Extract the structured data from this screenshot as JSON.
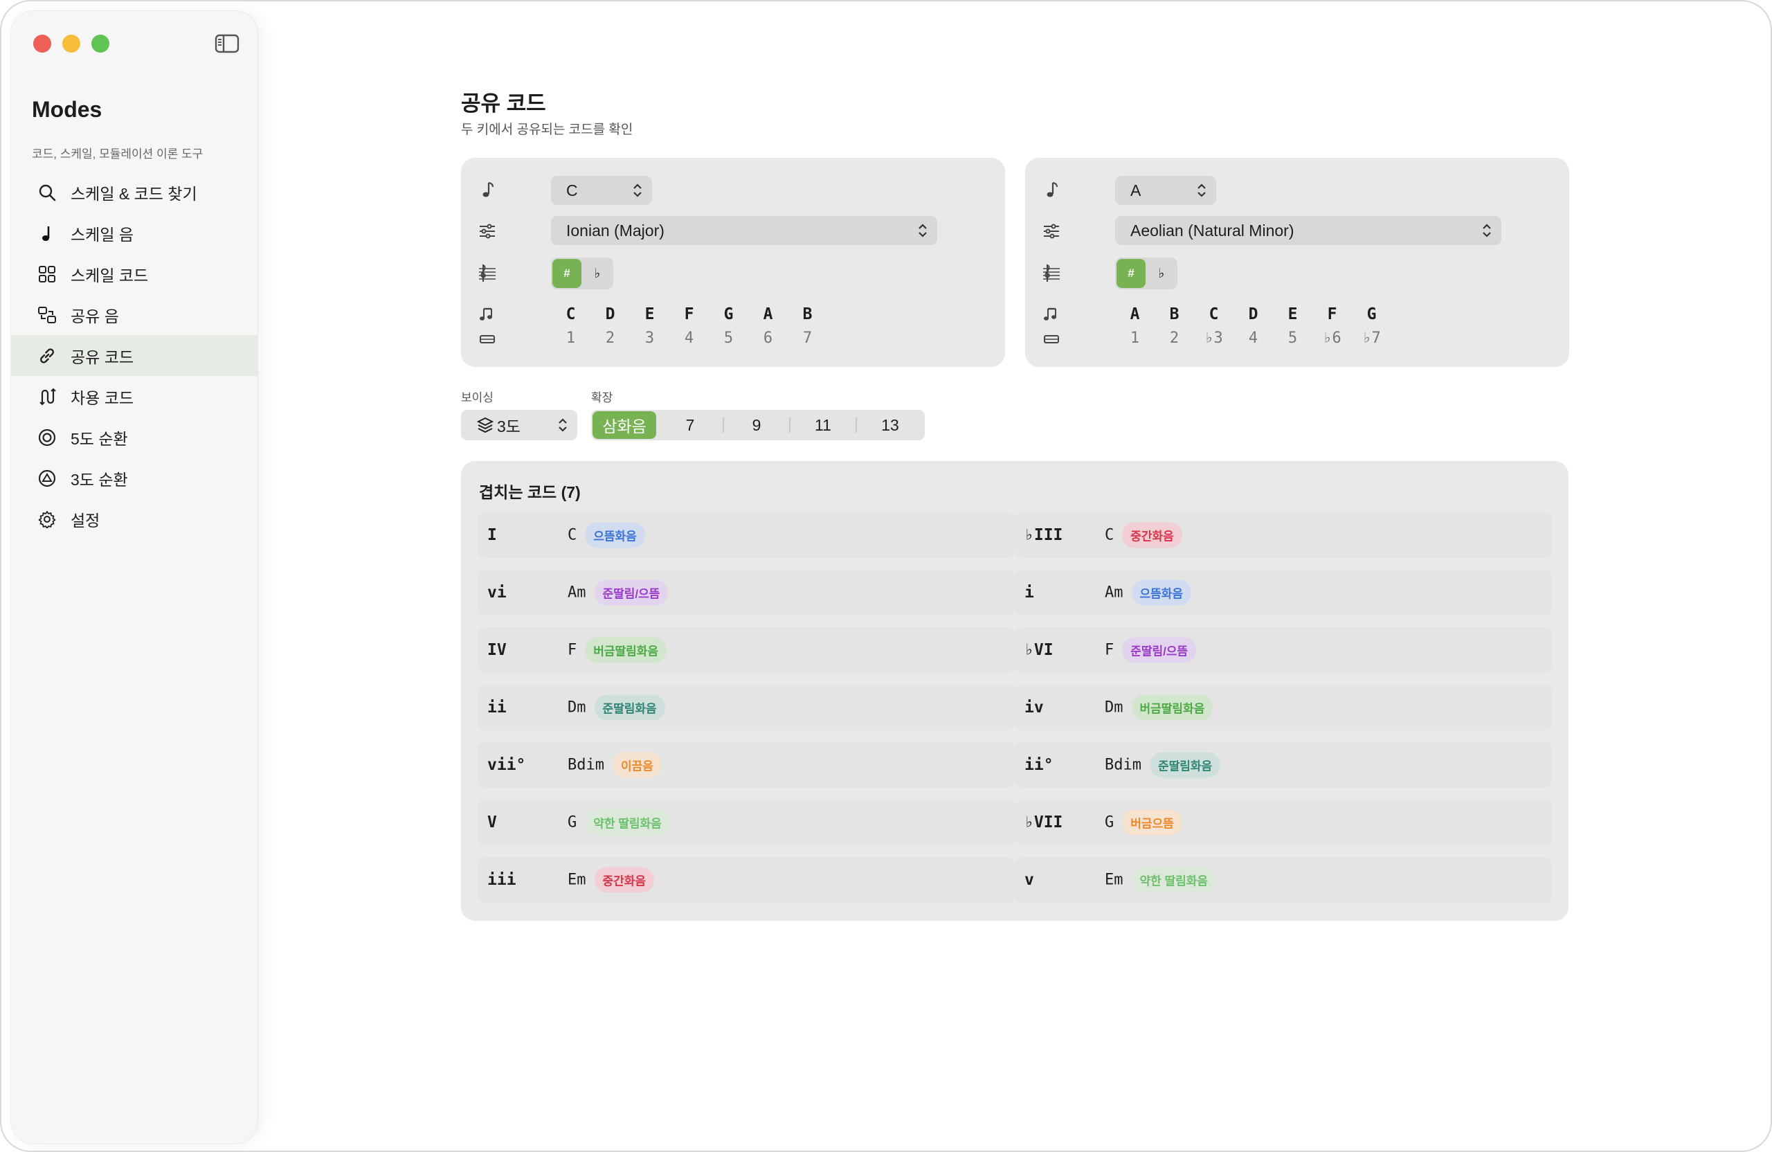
{
  "sidebar": {
    "app_title": "Modes",
    "app_subtitle": "코드, 스케일, 모듈레이션 이론 도구",
    "items": [
      {
        "label": "스케일 & 코드 찾기",
        "icon": "magnifier-icon"
      },
      {
        "label": "스케일 음",
        "icon": "music-note-icon"
      },
      {
        "label": "스케일 코드",
        "icon": "grid-icon"
      },
      {
        "label": "공유 음",
        "icon": "shared-notes-icon"
      },
      {
        "label": "공유 코드",
        "icon": "link-icon",
        "active": true
      },
      {
        "label": "차용 코드",
        "icon": "borrow-icon"
      },
      {
        "label": "5도 순환",
        "icon": "circle-fifths-icon"
      },
      {
        "label": "3도 순환",
        "icon": "circle-thirds-icon"
      },
      {
        "label": "설정",
        "icon": "gear-icon"
      }
    ]
  },
  "main": {
    "title": "공유 코드",
    "subtitle": "두 키에서 공유되는 코드를 확인"
  },
  "key_left": {
    "root": "C",
    "mode": "Ionian (Major)",
    "sharp": "#",
    "flat": "♭",
    "notes": [
      "C",
      "D",
      "E",
      "F",
      "G",
      "A",
      "B"
    ],
    "degrees": [
      "1",
      "2",
      "3",
      "4",
      "5",
      "6",
      "7"
    ]
  },
  "key_right": {
    "root": "A",
    "mode": "Aeolian (Natural Minor)",
    "sharp": "#",
    "flat": "♭",
    "notes": [
      "A",
      "B",
      "C",
      "D",
      "E",
      "F",
      "G"
    ],
    "degrees": [
      "1",
      "2",
      "♭3",
      "4",
      "5",
      "♭6",
      "♭7"
    ]
  },
  "controls": {
    "voicing_label": "보이싱",
    "voicing_value": "3도",
    "extension_label": "확장",
    "extensions": [
      "삼화음",
      "7",
      "9",
      "11",
      "13"
    ],
    "active_extension": "삼화음"
  },
  "results": {
    "title": "겹치는 코드 (7)",
    "rows": [
      {
        "left": {
          "roman": "I",
          "chord": "C",
          "badge": "으뜸화음",
          "tone": "blue"
        },
        "right": {
          "roman": "♭III",
          "chord": "C",
          "badge": "중간화음",
          "tone": "red"
        }
      },
      {
        "left": {
          "roman": "vi",
          "chord": "Am",
          "badge": "준딸림/으뜸",
          "tone": "purple"
        },
        "right": {
          "roman": "i",
          "chord": "Am",
          "badge": "으뜸화음",
          "tone": "blue"
        }
      },
      {
        "left": {
          "roman": "IV",
          "chord": "F",
          "badge": "버금딸림화음",
          "tone": "green"
        },
        "right": {
          "roman": "♭VI",
          "chord": "F",
          "badge": "준딸림/으뜸",
          "tone": "purple"
        }
      },
      {
        "left": {
          "roman": "ii",
          "chord": "Dm",
          "badge": "준딸림화음",
          "tone": "teal"
        },
        "right": {
          "roman": "iv",
          "chord": "Dm",
          "badge": "버금딸림화음",
          "tone": "green"
        }
      },
      {
        "left": {
          "roman": "vii°",
          "chord": "Bdim",
          "badge": "이끔음",
          "tone": "orange"
        },
        "right": {
          "roman": "ii°",
          "chord": "Bdim",
          "badge": "준딸림화음",
          "tone": "teal"
        }
      },
      {
        "left": {
          "roman": "V",
          "chord": "G",
          "badge": "약한 딸림화음",
          "tone": "lightgreen"
        },
        "right": {
          "roman": "♭VII",
          "chord": "G",
          "badge": "버금으뜸",
          "tone": "orange"
        }
      },
      {
        "left": {
          "roman": "iii",
          "chord": "Em",
          "badge": "중간화음",
          "tone": "red"
        },
        "right": {
          "roman": "v",
          "chord": "Em",
          "badge": "약한 딸림화음",
          "tone": "lightgreen"
        }
      }
    ]
  },
  "colors": {
    "accent": "#77b253",
    "blue": {
      "bg": "#d2dcf0",
      "fg": "#3b73d6"
    },
    "red": {
      "bg": "#f1cfd4",
      "fg": "#d8344a"
    },
    "purple": {
      "bg": "#e2d3ee",
      "fg": "#9b3bc9"
    },
    "green": {
      "bg": "#d2e6cd",
      "fg": "#4caa45"
    },
    "teal": {
      "bg": "#cfdfdb",
      "fg": "#2f8574"
    },
    "orange": {
      "bg": "#f5e2cf",
      "fg": "#eb8a2c"
    },
    "lightgreen": {
      "bg": "#dce9da",
      "fg": "#6cc06b"
    }
  }
}
